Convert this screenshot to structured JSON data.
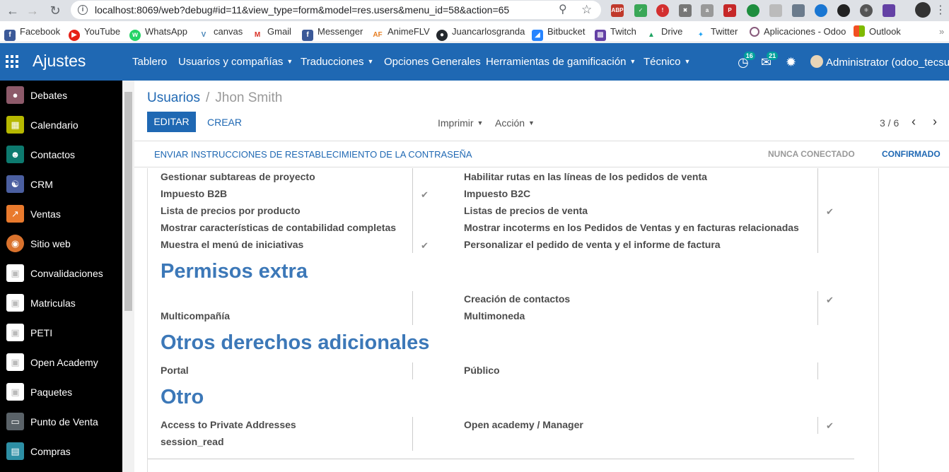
{
  "browser": {
    "url": "localhost:8069/web?debug#id=11&view_type=form&model=res.users&menu_id=58&action=65",
    "bookmarks": [
      "Facebook",
      "YouTube",
      "WhatsApp",
      "canvas",
      "Gmail",
      "Messenger",
      "AnimeFLV",
      "Juancarlosgranda",
      "Bitbucket",
      "Twitch",
      "Drive",
      "Twitter",
      "Aplicaciones - Odoo",
      "Outlook"
    ],
    "extensions": [
      "ABP",
      "shield",
      "reader",
      "tools",
      "amazon",
      "pdf",
      "leaf",
      "cube",
      "link",
      "world",
      "circle",
      "react",
      "twitch"
    ]
  },
  "topbar": {
    "app_title": "Ajustes",
    "menu": [
      {
        "label": "Tablero",
        "dropdown": false
      },
      {
        "label": "Usuarios y compañías",
        "dropdown": true
      },
      {
        "label": "Traducciones",
        "dropdown": true
      },
      {
        "label": "Opciones Generales",
        "dropdown": false
      },
      {
        "label": "Herramientas de gamificación",
        "dropdown": true
      },
      {
        "label": "Técnico",
        "dropdown": true
      }
    ],
    "activity_count": "16",
    "messages_count": "21",
    "user": "Administrator (odoo_tecsup"
  },
  "sidebar": {
    "items": [
      {
        "label": "Debates",
        "icon": "chat-icon",
        "color": "#8d5a6a"
      },
      {
        "label": "Calendario",
        "icon": "calendar-icon",
        "color": "#b6b800"
      },
      {
        "label": "Contactos",
        "icon": "contacts-icon",
        "color": "#0d7a6f"
      },
      {
        "label": "CRM",
        "icon": "handshake-icon",
        "color": "#4b5fa0"
      },
      {
        "label": "Ventas",
        "icon": "chart-icon",
        "color": "#e97a2d"
      },
      {
        "label": "Sitio web",
        "icon": "globe-icon",
        "color": "#d9722d"
      },
      {
        "label": "Convalidaciones",
        "icon": "camera-icon",
        "color": "#ffffff"
      },
      {
        "label": "Matriculas",
        "icon": "camera-icon",
        "color": "#ffffff"
      },
      {
        "label": "PETI",
        "icon": "camera-icon",
        "color": "#ffffff"
      },
      {
        "label": "Open Academy",
        "icon": "camera-icon",
        "color": "#ffffff"
      },
      {
        "label": "Paquetes",
        "icon": "camera-icon",
        "color": "#ffffff"
      },
      {
        "label": "Punto de Venta",
        "icon": "monitor-icon",
        "color": "#5a6268"
      },
      {
        "label": "Compras",
        "icon": "card-icon",
        "color": "#2d8fa5"
      }
    ]
  },
  "form": {
    "breadcrumb_parent": "Usuarios",
    "breadcrumb_current": "Jhon Smith",
    "edit_label": "EDITAR",
    "create_label": "CREAR",
    "print_label": "Imprimir",
    "action_label": "Acción",
    "pager": "3 / 6",
    "reset_password": "ENVIAR INSTRUCCIONES DE RESTABLECIMIENTO DE LA CONTRASEÑA",
    "state_never": "NUNCA CONECTADO",
    "state_confirmed": "CONFIRMADO"
  },
  "groups_top": [
    {
      "left": "Gestionar subtareas de proyecto",
      "left_checked": false,
      "right": "Habilitar rutas en las líneas de los pedidos de venta",
      "right_checked": false
    },
    {
      "left": "Impuesto B2B",
      "left_checked": true,
      "right": "Impuesto B2C",
      "right_checked": false
    },
    {
      "left": "Lista de precios por producto",
      "left_checked": false,
      "right": "Listas de precios de venta",
      "right_checked": true
    },
    {
      "left": "Mostrar características de contabilidad completas",
      "left_checked": false,
      "right": "Mostrar incoterms en los Pedidos de Ventas y en facturas relacionadas",
      "right_checked": false
    },
    {
      "left": "Muestra el menú de iniciativas",
      "left_checked": true,
      "right": "Personalizar el pedido de venta y el informe de factura",
      "right_checked": false
    }
  ],
  "sections": {
    "extra": {
      "title": "Permisos extra",
      "rows": [
        {
          "left": "",
          "left_checked": false,
          "right": "Creación de contactos",
          "right_checked": true
        },
        {
          "left": "Multicompañía",
          "left_checked": false,
          "right": "Multimoneda",
          "right_checked": false
        }
      ]
    },
    "other_rights": {
      "title": "Otros derechos adicionales",
      "rows": [
        {
          "left": "Portal",
          "left_checked": false,
          "right": "Público",
          "right_checked": false
        }
      ]
    },
    "other": {
      "title": "Otro",
      "rows": [
        {
          "left": "Access to Private Addresses",
          "left_checked": false,
          "right": "Open academy / Manager",
          "right_checked": true
        },
        {
          "left": "session_read",
          "left_checked": false,
          "right": "",
          "right_checked": false
        }
      ]
    }
  },
  "colors": {
    "odoo_blue": "#1f68b3",
    "section_blue": "#3c78b8",
    "sidebar_bg": "#000000"
  }
}
